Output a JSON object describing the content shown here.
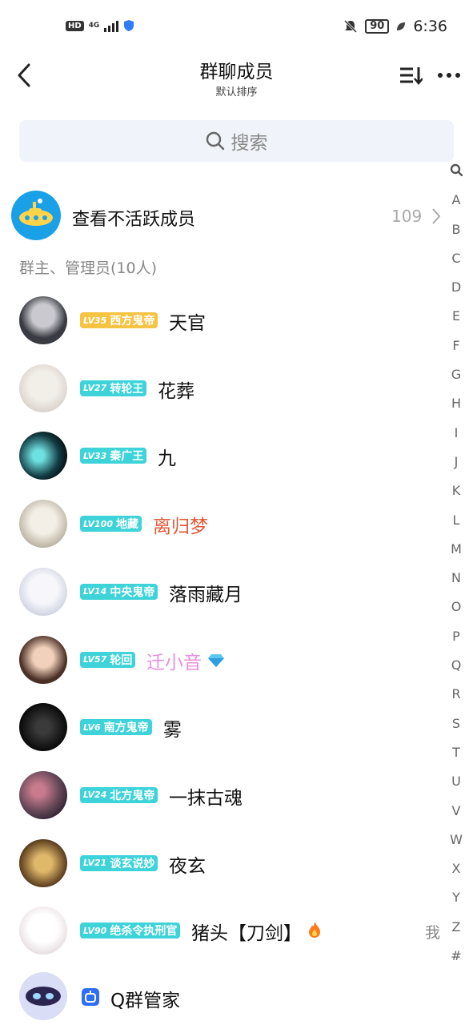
{
  "status_bar": {
    "hd": "HD",
    "network": "4G",
    "battery": "90",
    "time": "6:36",
    "icons": [
      "signal-icon",
      "shield-icon",
      "bell-off-icon",
      "battery-icon",
      "leaf-icon"
    ]
  },
  "header": {
    "title": "群聊成员",
    "subtitle": "默认排序",
    "icons": [
      "back-icon",
      "sort-icon",
      "more-icon"
    ]
  },
  "search": {
    "placeholder": "搜索",
    "icon": "search-icon"
  },
  "inactive": {
    "label": "查看不活跃成员",
    "count": "109",
    "icon": "submarine-icon"
  },
  "section_title": "群主、管理员(10人)",
  "index_letters": [
    "A",
    "B",
    "C",
    "D",
    "E",
    "F",
    "G",
    "H",
    "I",
    "J",
    "K",
    "L",
    "M",
    "N",
    "O",
    "P",
    "Q",
    "R",
    "S",
    "T",
    "U",
    "V",
    "W",
    "X",
    "Y",
    "Z",
    "#"
  ],
  "members": [
    {
      "lv": "LV35",
      "rank": "西方鬼帝",
      "name": "天官",
      "badge_color": "#f6c342",
      "name_color": "#111111"
    },
    {
      "lv": "LV27",
      "rank": "转轮王",
      "name": "花葬",
      "badge_color": "#3dd3d9",
      "name_color": "#111111"
    },
    {
      "lv": "LV33",
      "rank": "秦广王",
      "name": "九",
      "badge_color": "#3dd3d9",
      "name_color": "#111111"
    },
    {
      "lv": "LV100",
      "rank": "地藏",
      "name": "离归梦",
      "badge_color": "#3dd3d9",
      "name_color": "#e05a3a"
    },
    {
      "lv": "LV14",
      "rank": "中央鬼帝",
      "name": "落雨藏月",
      "badge_color": "#3dd3d9",
      "name_color": "#111111"
    },
    {
      "lv": "LV57",
      "rank": "轮回",
      "name": "迁小音",
      "badge_color": "#3dd3d9",
      "name_color": "#e98ee0"
    },
    {
      "lv": "LV6",
      "rank": "南方鬼帝",
      "name": "雾",
      "badge_color": "#3dd3d9",
      "name_color": "#111111"
    },
    {
      "lv": "LV24",
      "rank": "北方鬼帝",
      "name": "一抹古魂",
      "badge_color": "#3dd3d9",
      "name_color": "#111111"
    },
    {
      "lv": "LV21",
      "rank": "谈玄说妙",
      "name": "夜玄",
      "badge_color": "#3dd3d9",
      "name_color": "#111111"
    },
    {
      "lv": "LV90",
      "rank": "绝杀令执刑官",
      "name": "猪头【刀剑】",
      "badge_color": "#3dd3d9",
      "name_color": "#111111"
    }
  ],
  "me_label": "我",
  "bot": {
    "name": "Q群管家",
    "icon": "robot-icon"
  },
  "colors": {
    "accent": "#3dd3d9",
    "gold": "#f6c342",
    "muted": "#888888"
  }
}
